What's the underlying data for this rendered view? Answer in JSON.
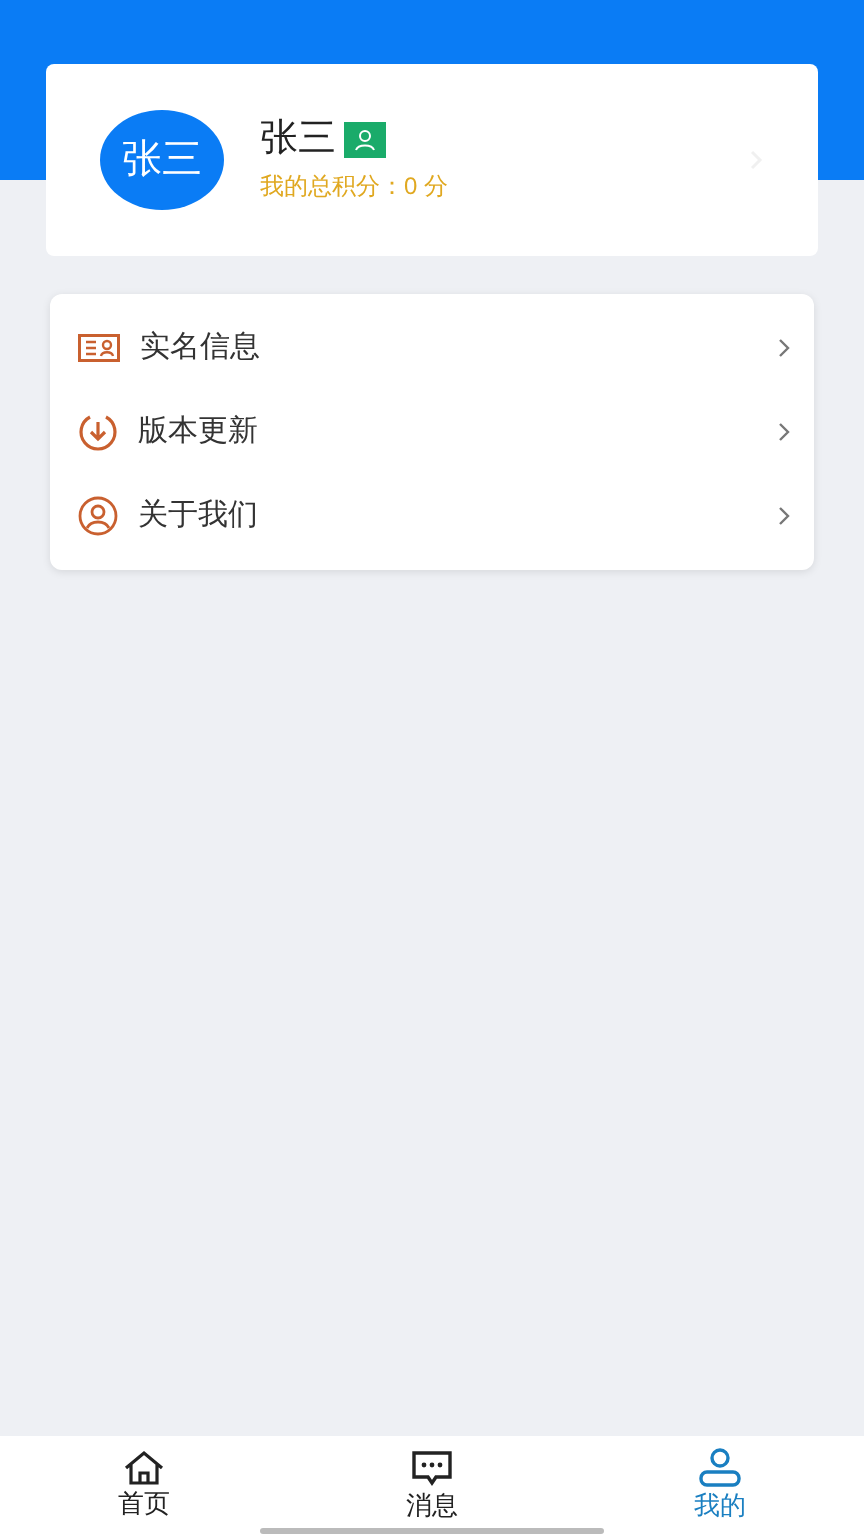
{
  "profile": {
    "avatar_text": "张三",
    "name": "张三",
    "points": "我的总积分：0 分"
  },
  "menu": [
    {
      "kind": "id",
      "label": "实名信息"
    },
    {
      "kind": "update",
      "label": "版本更新"
    },
    {
      "kind": "about",
      "label": "关于我们"
    }
  ],
  "tab_bar": [
    {
      "kind": "home",
      "label": "首页",
      "selected": false
    },
    {
      "kind": "message",
      "label": "消息",
      "selected": false
    },
    {
      "kind": "me",
      "label": "我的",
      "selected": true
    }
  ]
}
